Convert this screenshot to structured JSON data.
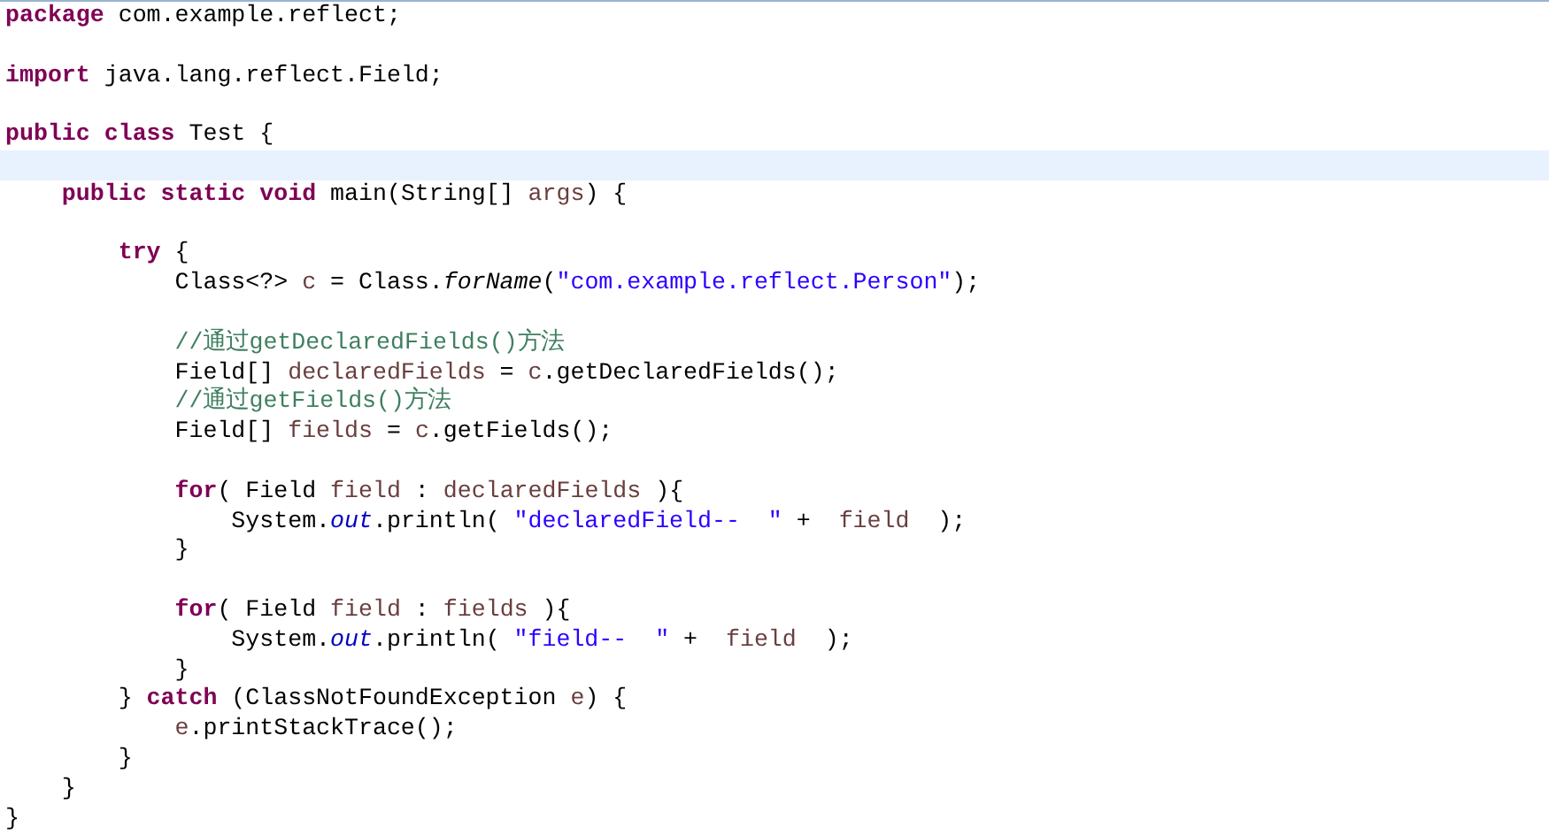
{
  "editor": {
    "lines": [
      {
        "kind": "code",
        "current": false,
        "tokens": [
          {
            "kind": "keyword",
            "text": "package"
          },
          {
            "kind": "plain",
            "text": " com.example.reflect;"
          }
        ]
      },
      {
        "kind": "blank"
      },
      {
        "kind": "code",
        "current": false,
        "tokens": [
          {
            "kind": "keyword",
            "text": "import"
          },
          {
            "kind": "plain",
            "text": " java.lang.reflect.Field;"
          }
        ]
      },
      {
        "kind": "blank"
      },
      {
        "kind": "code",
        "current": false,
        "tokens": [
          {
            "kind": "keyword",
            "text": "public class"
          },
          {
            "kind": "plain",
            "text": " Test {"
          }
        ]
      },
      {
        "kind": "blank",
        "current": true
      },
      {
        "kind": "code",
        "current": false,
        "tokens": [
          {
            "kind": "keyword",
            "text": "    public static void"
          },
          {
            "kind": "plain",
            "text": " main(String[] "
          },
          {
            "kind": "variable",
            "text": "args"
          },
          {
            "kind": "plain",
            "text": ") {"
          }
        ]
      },
      {
        "kind": "blank"
      },
      {
        "kind": "code",
        "current": false,
        "tokens": [
          {
            "kind": "keyword",
            "text": "        try"
          },
          {
            "kind": "plain",
            "text": " {"
          }
        ]
      },
      {
        "kind": "code",
        "current": false,
        "tokens": [
          {
            "kind": "plain",
            "text": "            Class<?> "
          },
          {
            "kind": "variable",
            "text": "c"
          },
          {
            "kind": "plain",
            "text": " = Class."
          },
          {
            "kind": "static-method",
            "text": "forName"
          },
          {
            "kind": "plain",
            "text": "("
          },
          {
            "kind": "string",
            "text": "\"com.example.reflect.Person\""
          },
          {
            "kind": "plain",
            "text": ");"
          }
        ]
      },
      {
        "kind": "blank"
      },
      {
        "kind": "code",
        "current": false,
        "tokens": [
          {
            "kind": "comment",
            "text": "            //通过getDeclaredFields()方法"
          }
        ]
      },
      {
        "kind": "code",
        "current": false,
        "tokens": [
          {
            "kind": "plain",
            "text": "            Field[] "
          },
          {
            "kind": "variable",
            "text": "declaredFields"
          },
          {
            "kind": "plain",
            "text": " = "
          },
          {
            "kind": "variable",
            "text": "c"
          },
          {
            "kind": "plain",
            "text": ".getDeclaredFields();"
          }
        ]
      },
      {
        "kind": "code",
        "current": false,
        "tokens": [
          {
            "kind": "comment",
            "text": "            //通过getFields()方法"
          }
        ]
      },
      {
        "kind": "code",
        "current": false,
        "tokens": [
          {
            "kind": "plain",
            "text": "            Field[] "
          },
          {
            "kind": "variable",
            "text": "fields"
          },
          {
            "kind": "plain",
            "text": " = "
          },
          {
            "kind": "variable",
            "text": "c"
          },
          {
            "kind": "plain",
            "text": ".getFields();"
          }
        ]
      },
      {
        "kind": "blank"
      },
      {
        "kind": "code",
        "current": false,
        "tokens": [
          {
            "kind": "keyword",
            "text": "            for"
          },
          {
            "kind": "plain",
            "text": "( Field "
          },
          {
            "kind": "variable",
            "text": "field"
          },
          {
            "kind": "plain",
            "text": " : "
          },
          {
            "kind": "variable",
            "text": "declaredFields"
          },
          {
            "kind": "plain",
            "text": " ){"
          }
        ]
      },
      {
        "kind": "code",
        "current": false,
        "tokens": [
          {
            "kind": "plain",
            "text": "                System."
          },
          {
            "kind": "static-field",
            "text": "out"
          },
          {
            "kind": "plain",
            "text": ".println( "
          },
          {
            "kind": "string",
            "text": "\"declaredField--  \""
          },
          {
            "kind": "plain",
            "text": " +  "
          },
          {
            "kind": "variable",
            "text": "field"
          },
          {
            "kind": "plain",
            "text": "  );"
          }
        ]
      },
      {
        "kind": "code",
        "current": false,
        "tokens": [
          {
            "kind": "plain",
            "text": "            }"
          }
        ]
      },
      {
        "kind": "blank"
      },
      {
        "kind": "code",
        "current": false,
        "tokens": [
          {
            "kind": "keyword",
            "text": "            for"
          },
          {
            "kind": "plain",
            "text": "( Field "
          },
          {
            "kind": "variable",
            "text": "field"
          },
          {
            "kind": "plain",
            "text": " : "
          },
          {
            "kind": "variable",
            "text": "fields"
          },
          {
            "kind": "plain",
            "text": " ){"
          }
        ]
      },
      {
        "kind": "code",
        "current": false,
        "tokens": [
          {
            "kind": "plain",
            "text": "                System."
          },
          {
            "kind": "static-field",
            "text": "out"
          },
          {
            "kind": "plain",
            "text": ".println( "
          },
          {
            "kind": "string",
            "text": "\"field--  \""
          },
          {
            "kind": "plain",
            "text": " +  "
          },
          {
            "kind": "variable",
            "text": "field"
          },
          {
            "kind": "plain",
            "text": "  );"
          }
        ]
      },
      {
        "kind": "code",
        "current": false,
        "tokens": [
          {
            "kind": "plain",
            "text": "            }"
          }
        ]
      },
      {
        "kind": "code",
        "current": false,
        "tokens": [
          {
            "kind": "plain",
            "text": "        } "
          },
          {
            "kind": "keyword",
            "text": "catch"
          },
          {
            "kind": "plain",
            "text": " (ClassNotFoundException "
          },
          {
            "kind": "variable",
            "text": "e"
          },
          {
            "kind": "plain",
            "text": ") {"
          }
        ]
      },
      {
        "kind": "code",
        "current": false,
        "tokens": [
          {
            "kind": "variable",
            "text": "            e"
          },
          {
            "kind": "plain",
            "text": ".printStackTrace();"
          }
        ]
      },
      {
        "kind": "code",
        "current": false,
        "tokens": [
          {
            "kind": "plain",
            "text": "        }"
          }
        ]
      },
      {
        "kind": "code",
        "current": false,
        "tokens": [
          {
            "kind": "plain",
            "text": "    }"
          }
        ]
      },
      {
        "kind": "code",
        "current": false,
        "tokens": [
          {
            "kind": "plain",
            "text": "}"
          }
        ]
      }
    ]
  }
}
